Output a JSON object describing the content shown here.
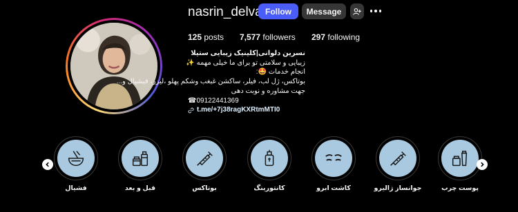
{
  "profile": {
    "username": "nasrin_delvani",
    "follow_label": "Follow",
    "message_label": "Message",
    "suggest_icon": "person-add-icon",
    "more_icon": "more-horizontal-icon"
  },
  "stats": {
    "posts_count": "125",
    "posts_label": "posts",
    "followers_count": "7,577",
    "followers_label": "followers",
    "following_count": "297",
    "following_label": "following"
  },
  "bio": {
    "name": "نسرین دلوانی|کلینیک زیبایی ستیلا",
    "line1": "زیبایی و سلامتی تو برای ما خیلی مهمه ✨",
    "line2": "انجام خدمات 🤩:",
    "line3": "بوتاکس، ژل لب، فیلر، ساکشن غبغب وشکم پهلو ،لیزر، فیشیال و...",
    "line4": "جهت مشاوره و نوبت دهی",
    "phone": "☎09122441369",
    "link": "t.me/+7j38ragKXRtmMTI0",
    "link_icon": "link-icon"
  },
  "highlights": [
    {
      "label": "فشیال",
      "icon": "facial-bowl-icon"
    },
    {
      "label": "قبل و بعد",
      "icon": "cosmetic-jars-icon"
    },
    {
      "label": "بوتاکس",
      "icon": "syringe-icon"
    },
    {
      "label": "کانتورینگ",
      "icon": "serum-bottle-icon"
    },
    {
      "label": "کاشت ابرو",
      "icon": "eyebrows-icon"
    },
    {
      "label": "جوانساز ژالیرو",
      "icon": "syringe-icon"
    },
    {
      "label": "پوست چرب",
      "icon": "cream-tube-icon"
    }
  ],
  "carousel": {
    "prev_icon": "chevron-left-icon",
    "next_icon": "chevron-right-icon"
  },
  "colors": {
    "background": "#000000",
    "follow_button": "#4a5df9",
    "secondary_button": "#363636",
    "highlight_fill": "#a9c9e0",
    "link_text": "#e0f1ff"
  }
}
